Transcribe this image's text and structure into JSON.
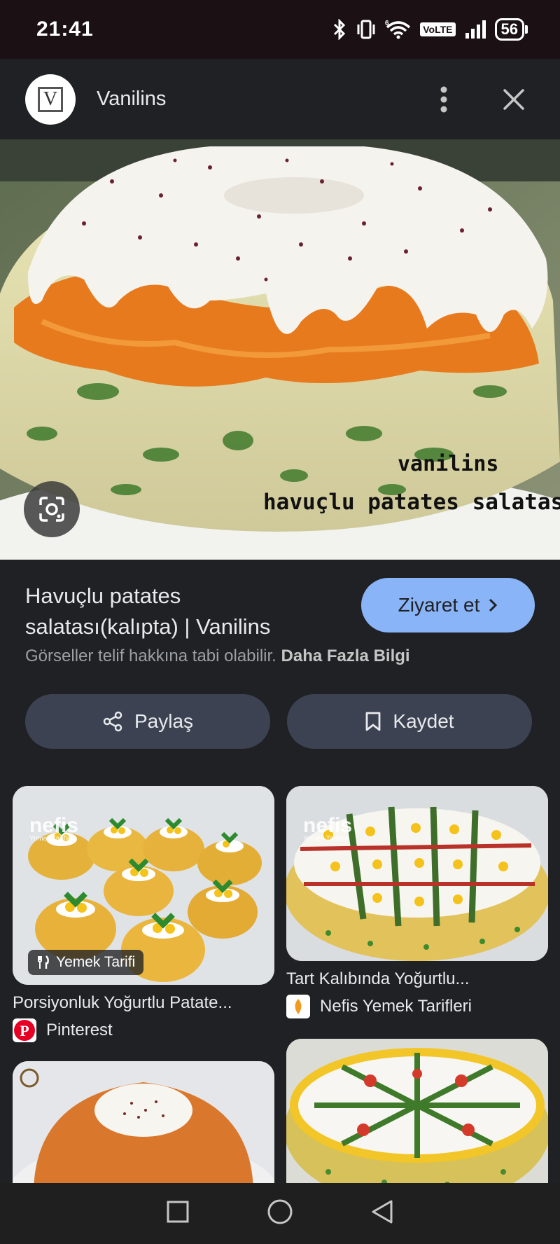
{
  "status_bar": {
    "time": "21:41",
    "network": "VoLTE",
    "battery": "56",
    "icons": [
      "bluetooth-icon",
      "vibrate-icon",
      "wifi-6-icon",
      "signal-icon",
      "battery-icon"
    ]
  },
  "header": {
    "site_logo_letter": "V",
    "site_name": "Vanilins",
    "icons": [
      "more-vert-icon",
      "close-icon"
    ]
  },
  "hero": {
    "watermark_line1": "vanilins",
    "watermark_line2": "havuçlu patates salatası",
    "lens_icon": "google-lens-icon"
  },
  "result": {
    "title": "Havuçlu patates salatası(kalıpta) | Vanilins",
    "visit_label": "Ziyaret et",
    "copyright_text": "Görseller telif hakkına tabi olabilir.",
    "copyright_link": "Daha Fazla Bilgi",
    "share_label": "Paylaş",
    "save_label": "Kaydet"
  },
  "related": [
    {
      "title": "Porsiyonluk Yoğurtlu Patate...",
      "source": "Pinterest",
      "badge": "Yemek Tarifi",
      "watermark": "nefis",
      "watermark_sub": "Yemek Tarifleri"
    },
    {
      "title": "Tart Kalıbında Yoğurtlu...",
      "source": "Nefis Yemek Tarifleri",
      "watermark": "nefis",
      "watermark_sub": "Yemek Tarifleri"
    },
    {
      "title": "",
      "source": ""
    },
    {
      "title": "",
      "source": ""
    }
  ],
  "nav_bar": {
    "icons": [
      "recents-icon",
      "home-icon",
      "back-icon"
    ]
  },
  "colors": {
    "background": "#202124",
    "accent_button": "#8ab4f8",
    "pill_button": "#3c4252",
    "pinterest": "#e60023"
  }
}
